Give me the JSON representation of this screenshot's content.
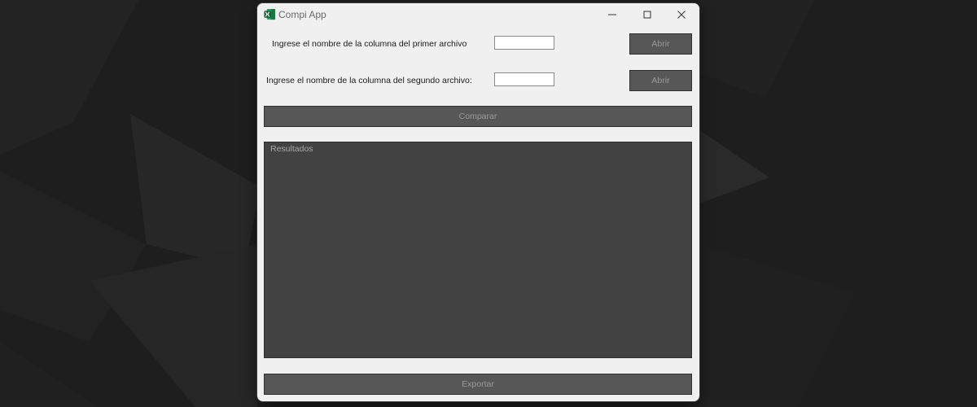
{
  "window": {
    "title": "Compi App",
    "app_icon": "excel-icon",
    "controls": [
      "minimize-icon",
      "maximize-icon",
      "close-icon"
    ]
  },
  "form": {
    "first_file": {
      "label": "Ingrese el nombre de la columna del primer archivo",
      "value": "",
      "button_label": "Abrir"
    },
    "second_file": {
      "label": "Ingrese el nombre de la columna del segundo archivo:",
      "value": "",
      "button_label": "Abrir"
    },
    "compare_label": "Comparar",
    "results_label": "Resultados",
    "export_label": "Exportar"
  },
  "colors": {
    "desktop_background": "#1e1e1e",
    "window_background": "#f0f0f0",
    "button_background": "#575757",
    "results_background": "#424242",
    "icon_green": "#1d7044"
  }
}
